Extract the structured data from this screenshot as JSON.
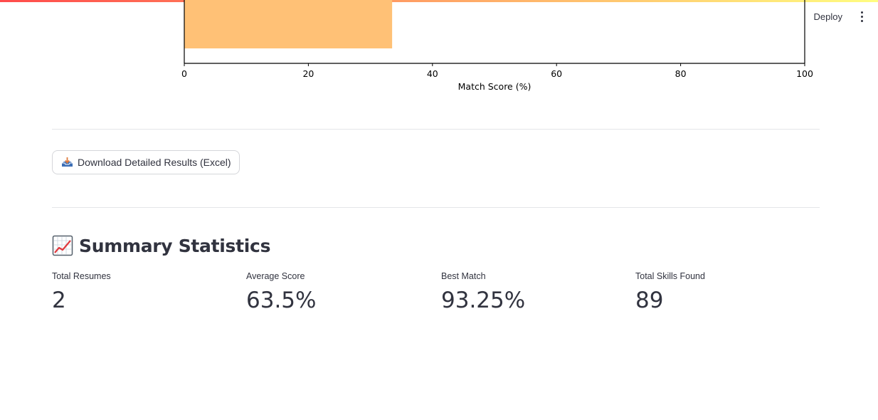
{
  "header": {
    "deploy_label": "Deploy",
    "menu_icon": "kebab-menu-icon"
  },
  "chart_data": {
    "type": "bar",
    "orientation": "horizontal",
    "categories": [
      ""
    ],
    "values": [
      33.5
    ],
    "bar_color": "#ffc176",
    "xlabel": "Match Score (%)",
    "xlim": [
      0,
      100
    ],
    "xticks": [
      "0",
      "20",
      "40",
      "60",
      "80",
      "100"
    ],
    "grid": false
  },
  "download": {
    "label": "Download Detailed Results (Excel)",
    "icon": "inbox-tray-icon"
  },
  "summary": {
    "title": "Summary Statistics",
    "icon": "chart-increasing-icon",
    "metrics": [
      {
        "label": "Total Resumes",
        "value": "2"
      },
      {
        "label": "Average Score",
        "value": "63.5%"
      },
      {
        "label": "Best Match",
        "value": "93.25%"
      },
      {
        "label": "Total Skills Found",
        "value": "89"
      }
    ]
  },
  "colors": {
    "accent_gradient_start": "#ff4b4b",
    "accent_gradient_end": "#fffd80",
    "text": "#31333f",
    "divider": "#e4e5e8"
  }
}
